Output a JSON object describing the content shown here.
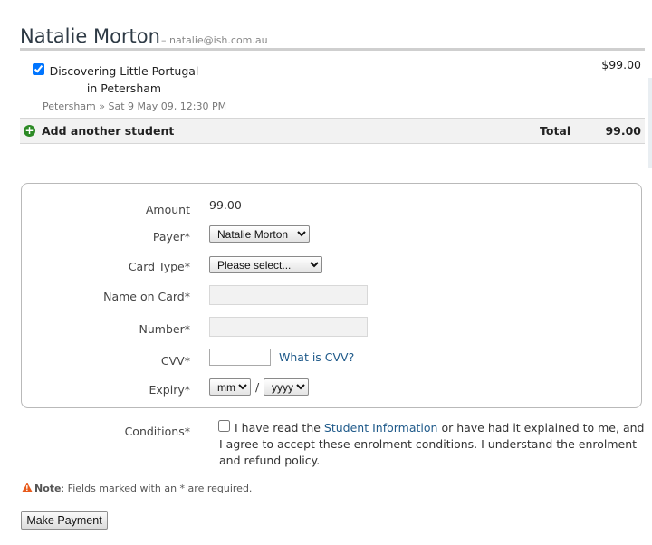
{
  "student": {
    "name": "Natalie Morton",
    "email": "– natalie@ish.com.au"
  },
  "enrolment": {
    "checked": true,
    "course_title": "Discovering Little Portugal in Petersham",
    "detail": "Petersham » Sat 9 May 09, 12:30 PM",
    "price": "$99.00"
  },
  "totals": {
    "add_student_label": "Add another student",
    "total_label": "Total",
    "total_value": "99.00"
  },
  "payment_form": {
    "amount_label": "Amount",
    "amount_value": "99.00",
    "payer_label": "Payer",
    "payer_selected": "Natalie Morton",
    "card_type_label": "Card Type",
    "card_type_selected": "Please select...",
    "name_on_card_label": "Name on Card",
    "number_label": "Number",
    "cvv_label": "CVV",
    "cvv_help_link": "What is CVV?",
    "expiry_label": "Expiry",
    "expiry_month": "mm",
    "expiry_separator": "/",
    "expiry_year": "yyyy",
    "required_marker": "*"
  },
  "conditions": {
    "label": "Conditions",
    "text_before": "I have read the ",
    "link": "Student Information",
    "text_after": " or have had it explained to me, and I agree to accept these enrolment conditions. I understand the enrolment and refund policy."
  },
  "note": {
    "label": "Note",
    "text": ": Fields marked with an * are required."
  },
  "submit_label": "Make Payment",
  "colors": {
    "link": "#1f5a8a",
    "add_icon": "#2c8a25",
    "warning_icon": "#e85a1b"
  },
  "icons": {
    "add": "plus-circle-icon",
    "warning": "warning-triangle-icon"
  }
}
